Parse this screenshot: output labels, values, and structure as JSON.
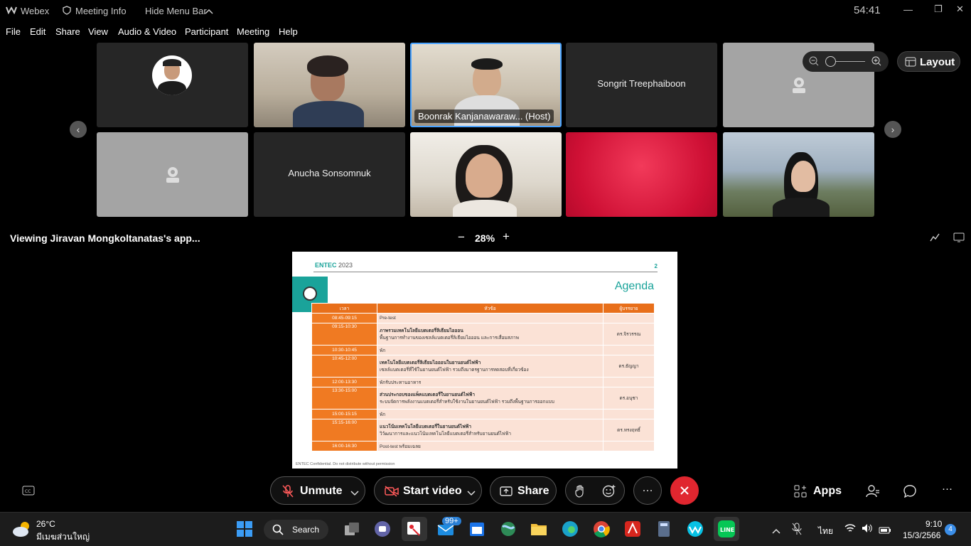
{
  "titlebar": {
    "app": "Webex",
    "meeting_info": "Meeting Info",
    "hide_menu": "Hide Menu Bar",
    "timer": "54:41"
  },
  "menu": [
    "File",
    "Edit",
    "Share",
    "View",
    "Audio & Video",
    "Participant",
    "Meeting",
    "Help"
  ],
  "participants": [
    {
      "name": "",
      "kind": "avatar"
    },
    {
      "name": "",
      "kind": "video"
    },
    {
      "name": "Boonrak Kanjanawaraw... (Host)",
      "kind": "video"
    },
    {
      "name": "Songrit Treephaiboon",
      "kind": "name"
    },
    {
      "name": "",
      "kind": "camera-off"
    },
    {
      "name": "",
      "kind": "camera-off"
    },
    {
      "name": "Anucha Sonsomnuk",
      "kind": "name"
    },
    {
      "name": "",
      "kind": "video"
    },
    {
      "name": "",
      "kind": "video"
    },
    {
      "name": "",
      "kind": "video"
    }
  ],
  "layout_label": "Layout",
  "share": {
    "viewing": "Viewing Jiravan Mongkoltanatas's app...",
    "zoom": "28%",
    "zoom_out": "−",
    "zoom_in": "+"
  },
  "slide": {
    "brand": "ENTEC",
    "year": "2023",
    "page": "2",
    "title": "Agenda",
    "headers": [
      "เวลา",
      "หัวข้อ",
      "ผู้บรรยาย"
    ],
    "rows": [
      {
        "time": "08:45-09:15",
        "topic": "Pre-test",
        "sub": "",
        "speaker": ""
      },
      {
        "time": "09:15-10:30",
        "topic": "ภาพรวมเทคโนโลยีแบตเตอรี่ลิเธียมไอออน",
        "sub": "พื้นฐานการทำงานของเซลล์แบตเตอรี่ลิเธียมไอออน และการเสื่อมสภาพ",
        "speaker": "ดร.จิรวรรณ"
      },
      {
        "time": "10:30-10:45",
        "topic": "พัก",
        "sub": "",
        "speaker": ""
      },
      {
        "time": "10:45-12:00",
        "topic": "เทคโนโลยีแบตเตอรี่ลิเธียมไอออนในยานยนต์ไฟฟ้า",
        "sub": "เซลล์แบตเตอรี่ที่ใช้ในยานยนต์ไฟฟ้า รวมถึงมาตรฐานการทดสอบที่เกี่ยวข้อง",
        "speaker": "ดร.ธัญญา"
      },
      {
        "time": "12:00-13:30",
        "topic": "พักรับประทานอาหาร",
        "sub": "",
        "speaker": ""
      },
      {
        "time": "13:30-15:00",
        "topic": "ส่วนประกอบของแพ็คแบตเตอรี่ในยานยนต์ไฟฟ้า",
        "sub": "ระบบจัดการพลังงานแบตเตอรี่สำหรับใช้งานในยานยนต์ไฟฟ้า รวมถึงพื้นฐานการออกแบบ",
        "speaker": "ดร.อนุชา"
      },
      {
        "time": "15:00-15:15",
        "topic": "พัก",
        "sub": "",
        "speaker": ""
      },
      {
        "time": "15:15-16:00",
        "topic": "แนวโน้มเทคโนโลยีแบตเตอรี่ในยานยนต์ไฟฟ้า",
        "sub": "วิวัฒนาการและแนวโน้มเทคโนโลยีแบตเตอรี่สำหรับยานยนต์ไฟฟ้า",
        "speaker": "ดร.ทรงฤทธิ์"
      },
      {
        "time": "16:00-16:30",
        "topic": "Post-test พร้อมเฉลย",
        "sub": "",
        "speaker": ""
      }
    ],
    "footer": "ENTEC  Confidential.   Do not distribute without permission"
  },
  "controls": {
    "unmute": "Unmute",
    "start_video": "Start video",
    "share": "Share",
    "apps": "Apps"
  },
  "taskbar": {
    "weather_temp": "26°C",
    "weather_desc": "มีเมฆส่วนใหญ่",
    "search": "Search",
    "mail_badge": "99+",
    "lang": "ไทย",
    "time": "9:10",
    "date": "15/3/2566",
    "notif": "4"
  },
  "colors": {
    "accent_teal": "#1aa39a",
    "slide_orange": "#e86f1a",
    "leave_red": "#e0262f",
    "host_border": "#4aa3ff"
  }
}
